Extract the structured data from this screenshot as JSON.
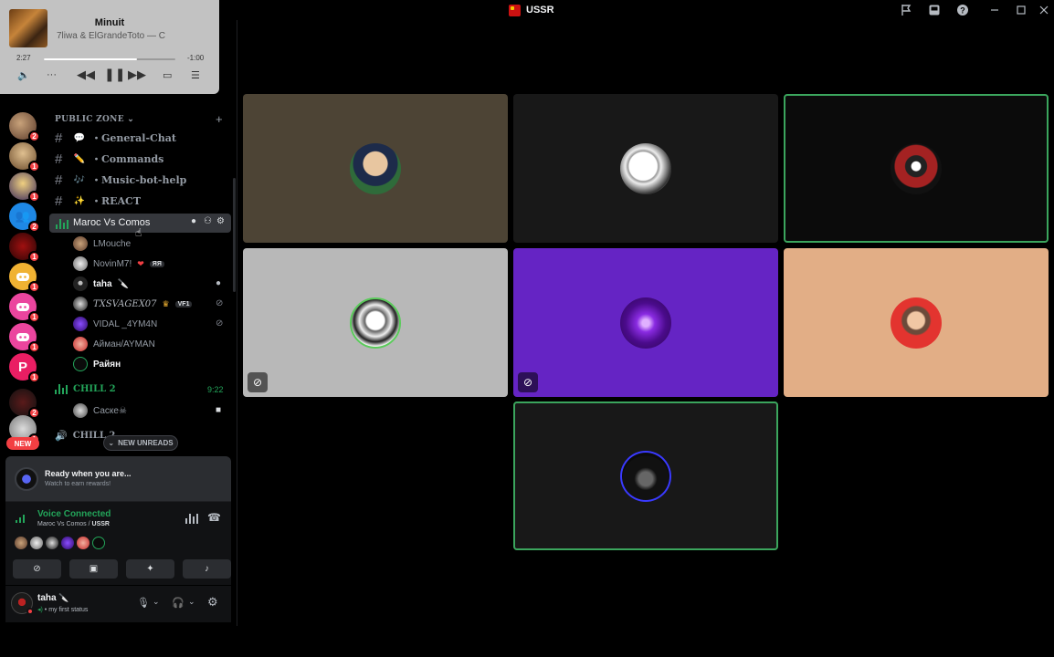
{
  "window": {
    "title": "USSR"
  },
  "player": {
    "song": "Minuit",
    "artist": "7liwa & ElGrandeToto — C",
    "elapsed": "2:27",
    "remaining": "-1:00",
    "progress": 0.71
  },
  "servers": [
    {
      "badge": "1"
    },
    {
      "badge": "2"
    },
    {
      "badge": "1"
    },
    {
      "badge": "1"
    },
    {
      "badge": "2"
    },
    {
      "badge": "1"
    },
    {
      "badge": "1"
    },
    {
      "badge": "1"
    },
    {
      "badge": "1"
    },
    {
      "badge": "1"
    },
    {
      "badge": "2"
    },
    {
      "badge": "1"
    }
  ],
  "rail_new": "NEW",
  "category": {
    "label": "PUBLIC ZONE"
  },
  "channels": [
    {
      "name": "・General-Chat",
      "emoji": "💬"
    },
    {
      "name": "・Commands",
      "emoji": "✏️"
    },
    {
      "name": "・Music-bot-help",
      "emoji": "🎶"
    },
    {
      "name": "・REACT",
      "emoji": "✨"
    }
  ],
  "voice_channel": {
    "name": "Maroc Vs Comos"
  },
  "voice_users": [
    {
      "name": "LMouche",
      "color": "#949ba4"
    },
    {
      "name": "NovinM7!",
      "tag": "ЯЯ",
      "color": "#949ba4"
    },
    {
      "name": "taha",
      "suffix": "🔪",
      "color": "#f2f3f5"
    },
    {
      "name": "TXSVAGEX07",
      "tag": "VF1",
      "color": "#b5bac1"
    },
    {
      "name": "VIDAL _4YM4N",
      "color": "#949ba4"
    },
    {
      "name": "Айман/AYMAN",
      "color": "#949ba4"
    },
    {
      "name": "Райян",
      "color": "#f2f3f5"
    }
  ],
  "chill2": {
    "name": "CHILL 2",
    "time": "9:22",
    "user": "Саске☠"
  },
  "chill3": {
    "name": "CHILL 2"
  },
  "new_unreads": "NEW UNREADS",
  "reward": {
    "title": "Ready when you are...",
    "subtitle": "Watch to earn rewards!"
  },
  "voice_panel": {
    "status": "Voice Connected",
    "channel": "Maroc Vs Comos / ",
    "server": "USSR"
  },
  "user_panel": {
    "name": "taha",
    "status": "my first status"
  },
  "tiles_colors": [
    "#4d4435",
    "#181818",
    "#0b0b0b",
    "#b8b8b8",
    "#6524c4",
    "#e2ae86",
    "#181818"
  ],
  "speaking_color": "#3ba55d"
}
